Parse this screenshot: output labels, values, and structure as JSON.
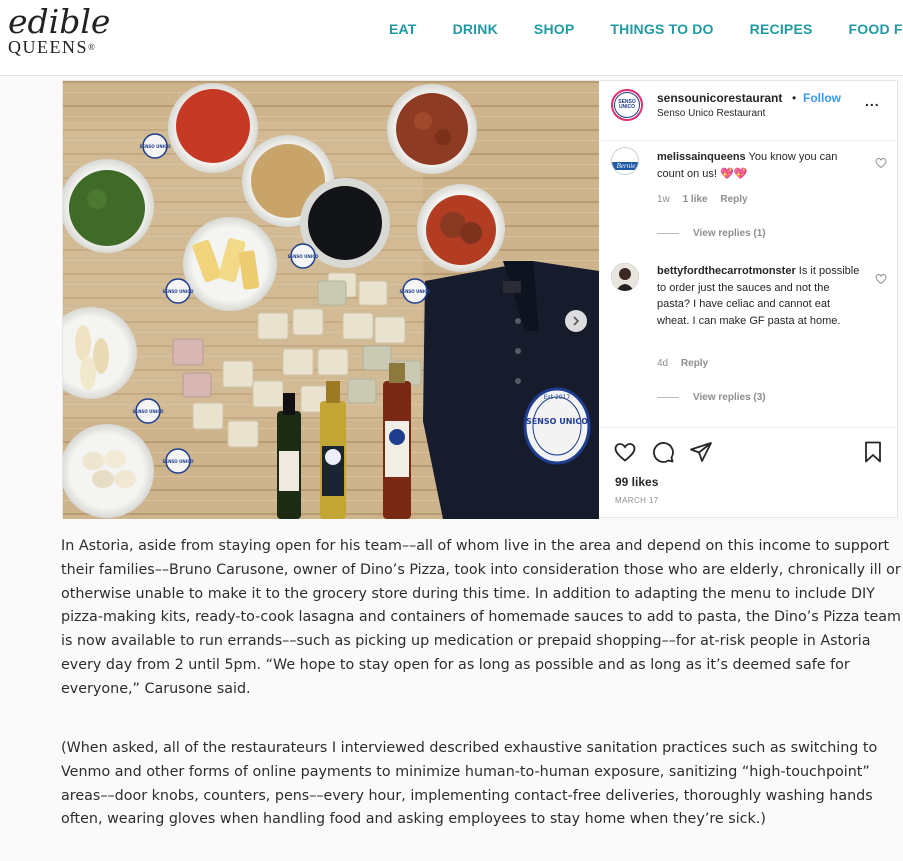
{
  "header": {
    "logo_top": "edible",
    "logo_bottom": "QUEENS",
    "logo_mark": "®",
    "nav": [
      "EAT",
      "DRINK",
      "SHOP",
      "THINGS TO DO",
      "RECIPES",
      "FOOD FOR T"
    ],
    "accent_color": "#1f9aa3"
  },
  "post": {
    "account": "sensounicorestaurant",
    "separator": "•",
    "follow": "Follow",
    "subtitle": "Senso Unico Restaurant",
    "more": "...",
    "avatar_text": "SENSO UNICO",
    "photo_sticker_text": "SENSO UNICO",
    "shirt_patch_top": "Est 2017",
    "shirt_patch_main": "SENSO UNICO",
    "comments": [
      {
        "user": "melissainqueens",
        "text": " You know you can count on us! 💖💖",
        "meta_time": "1w",
        "meta_likes": "1 like",
        "meta_reply": "Reply",
        "view_replies": "View replies (1)",
        "avatar_text": "Bernie"
      },
      {
        "user": "bettyfordthecarrotmonster",
        "text": " Is it possible to order just the sauces and not the pasta? I have celiac and cannot eat wheat. I can make GF pasta at home.",
        "meta_time": "4d",
        "meta_reply": "Reply",
        "view_replies": "View replies (3)"
      }
    ],
    "likes": "99 likes",
    "date": "MARCH 17",
    "icons": [
      "heart-icon",
      "comment-icon",
      "share-icon",
      "bookmark-icon"
    ]
  },
  "article": {
    "paragraph1": "In Astoria, aside from staying open for his team––all of whom live in the area and depend on this income to support their families––Bruno Carusone, owner of Dino’s Pizza, took into consideration those who are elderly, chronically ill or otherwise unable to make it to the grocery store during this time. In addition to adapting the menu to include DIY pizza-making kits, ready-to-cook lasagna and containers of homemade sauces to add to pasta, the Dino’s Pizza team is now available to run errands––such as picking up medication or prepaid shopping––for at-risk people in Astoria every day from 2 until 5pm. “We hope to stay open for as long as possible and as long as it’s deemed safe for everyone,” Carusone said.",
    "paragraph2": "(When asked, all of the restaurateurs I interviewed described exhaustive sanitation practices such as switching to Venmo and other forms of online payments to minimize human-to-human exposure, sanitizing “high-touchpoint” areas––door knobs, counters, pens––every hour, implementing contact-free deliveries, thoroughly washing hands often, wearing gloves when handling food and asking employees to stay home when they’re sick.)"
  }
}
